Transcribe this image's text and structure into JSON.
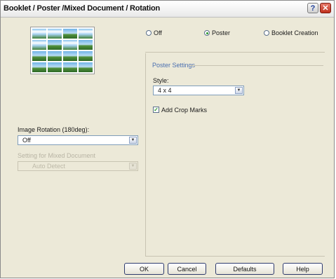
{
  "window": {
    "title": "Booklet / Poster /Mixed Document / Rotation"
  },
  "titlebar": {
    "help_glyph": "?",
    "close_glyph": "✕"
  },
  "mode": {
    "options": [
      {
        "label": "Off",
        "selected": false
      },
      {
        "label": "Poster",
        "selected": true
      },
      {
        "label": "Booklet Creation",
        "selected": false
      }
    ]
  },
  "poster_settings": {
    "group_label": "Poster Settings",
    "style_label": "Style:",
    "style_value": "4 x 4",
    "crop_marks_label": "Add Crop Marks",
    "crop_marks_checked": true
  },
  "image_rotation": {
    "label": "Image Rotation (180deg):",
    "value": "Off"
  },
  "mixed_document": {
    "label": "Setting for Mixed Document",
    "value": "Auto Detect",
    "enabled": false
  },
  "buttons": {
    "ok": "OK",
    "cancel": "Cancel",
    "defaults": "Defaults",
    "help": "Help"
  },
  "colors": {
    "dialog_bg": "#ece9d8",
    "accent_green": "#2a9a2a",
    "group_label_blue": "#4a6fb0",
    "close_red": "#c0301d"
  },
  "icons": {
    "thumbnail": "poster-preview-icon",
    "dropdown": "chevron-down-icon",
    "check": "checkmark-icon"
  }
}
